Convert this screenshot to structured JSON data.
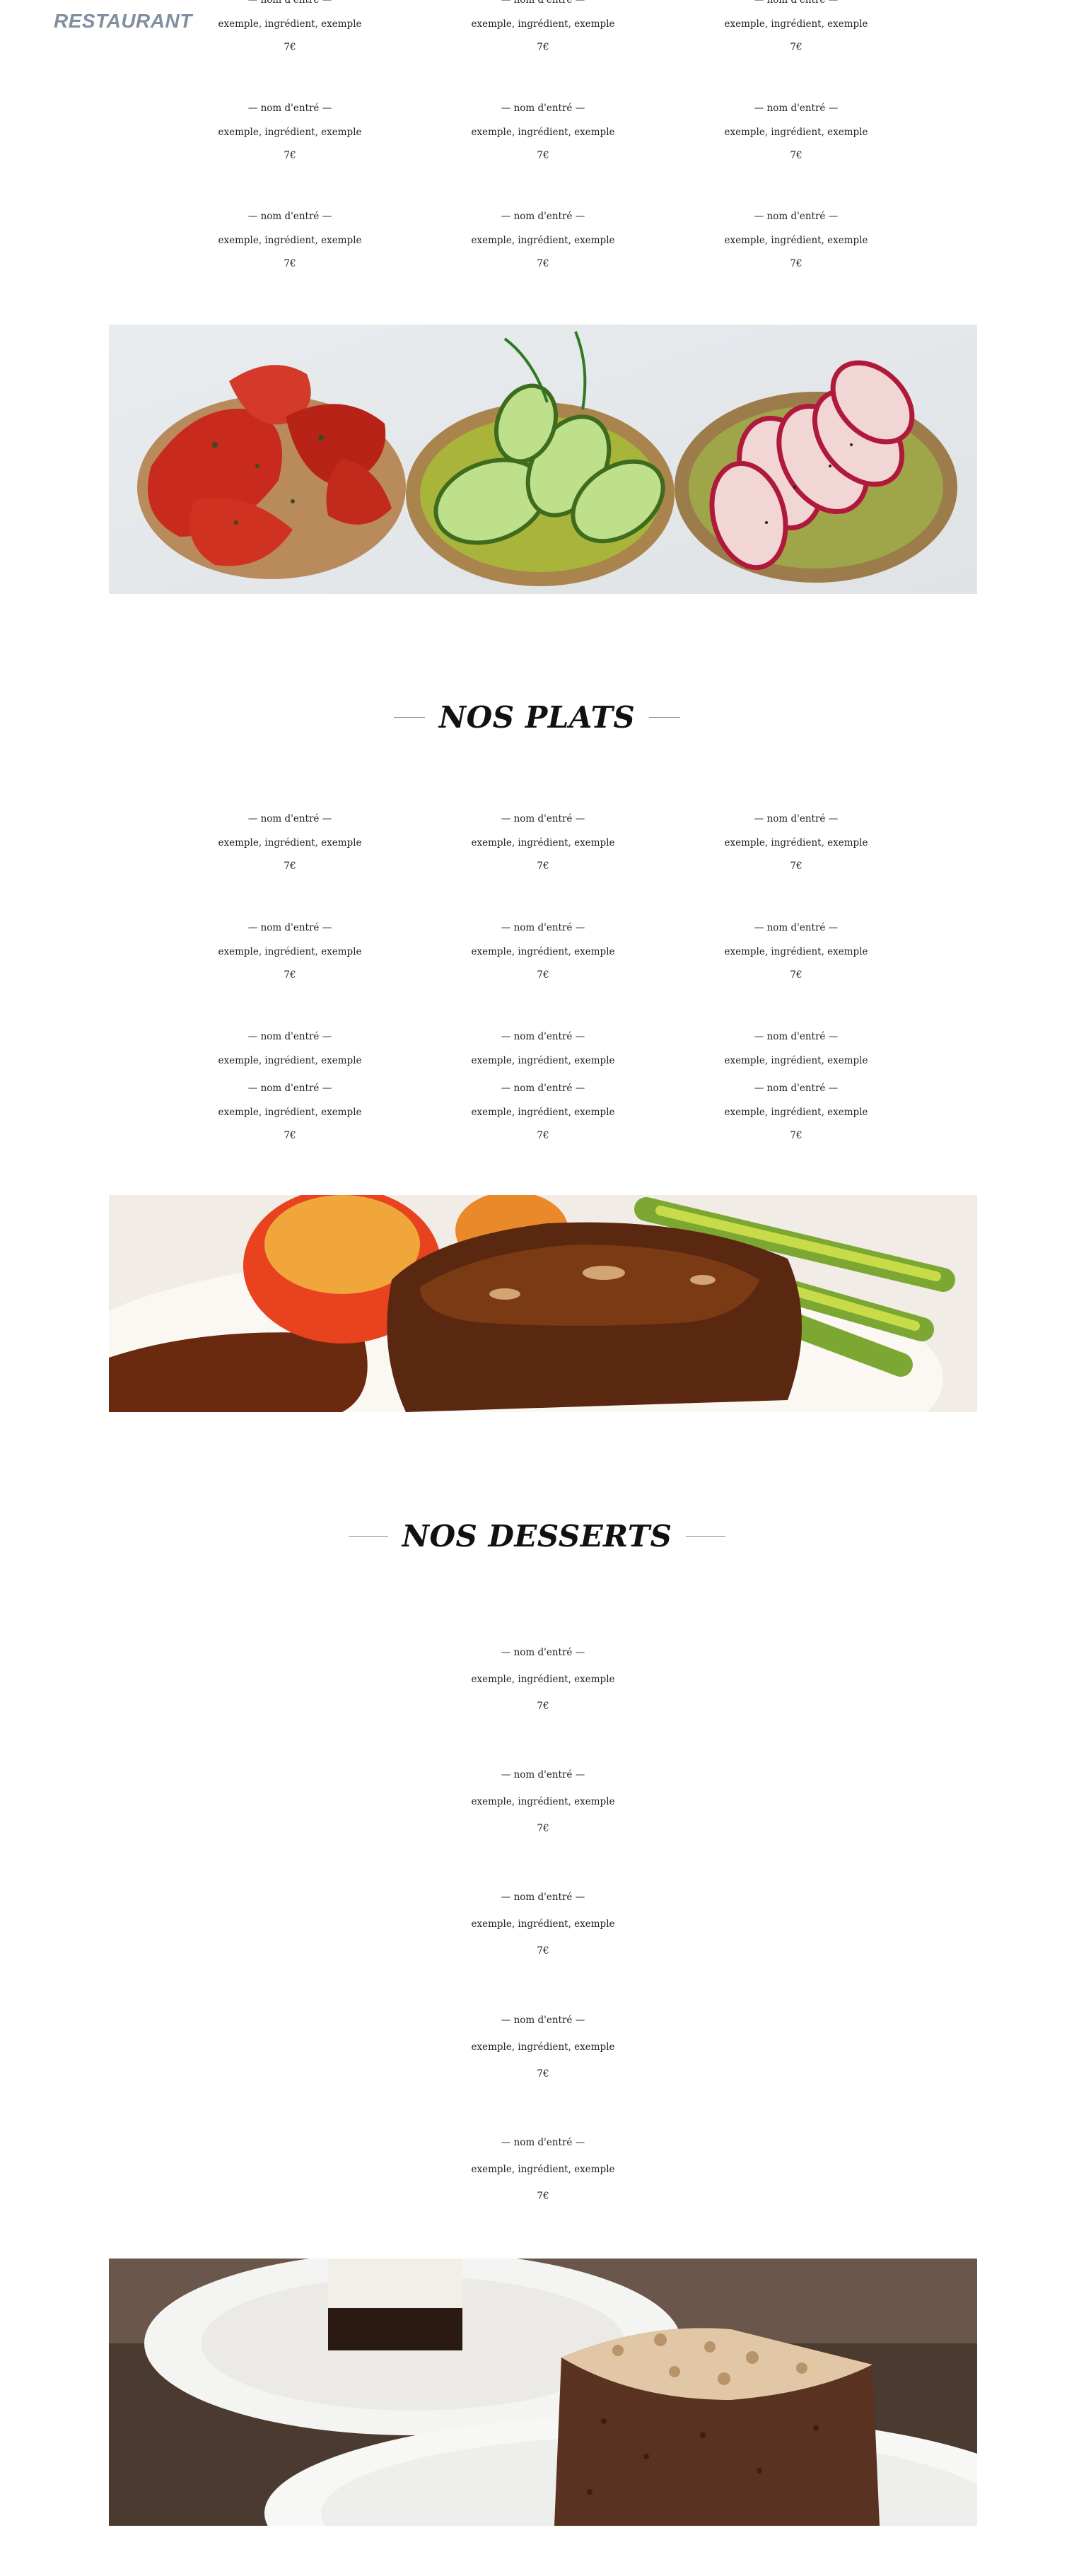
{
  "brand": {
    "logo": "RESTAURANT"
  },
  "menu_item": {
    "name": "— nom d'entré —",
    "ingredients": "exemple, ingrédient, exemple",
    "price": "7€"
  },
  "sections": {
    "plats_title": "NOS PLATS",
    "desserts_title": "NOS DESSERTS"
  },
  "images": {
    "entrees": "bruschetta-photo",
    "plats": "steak-photo",
    "desserts": "cake-photo"
  }
}
